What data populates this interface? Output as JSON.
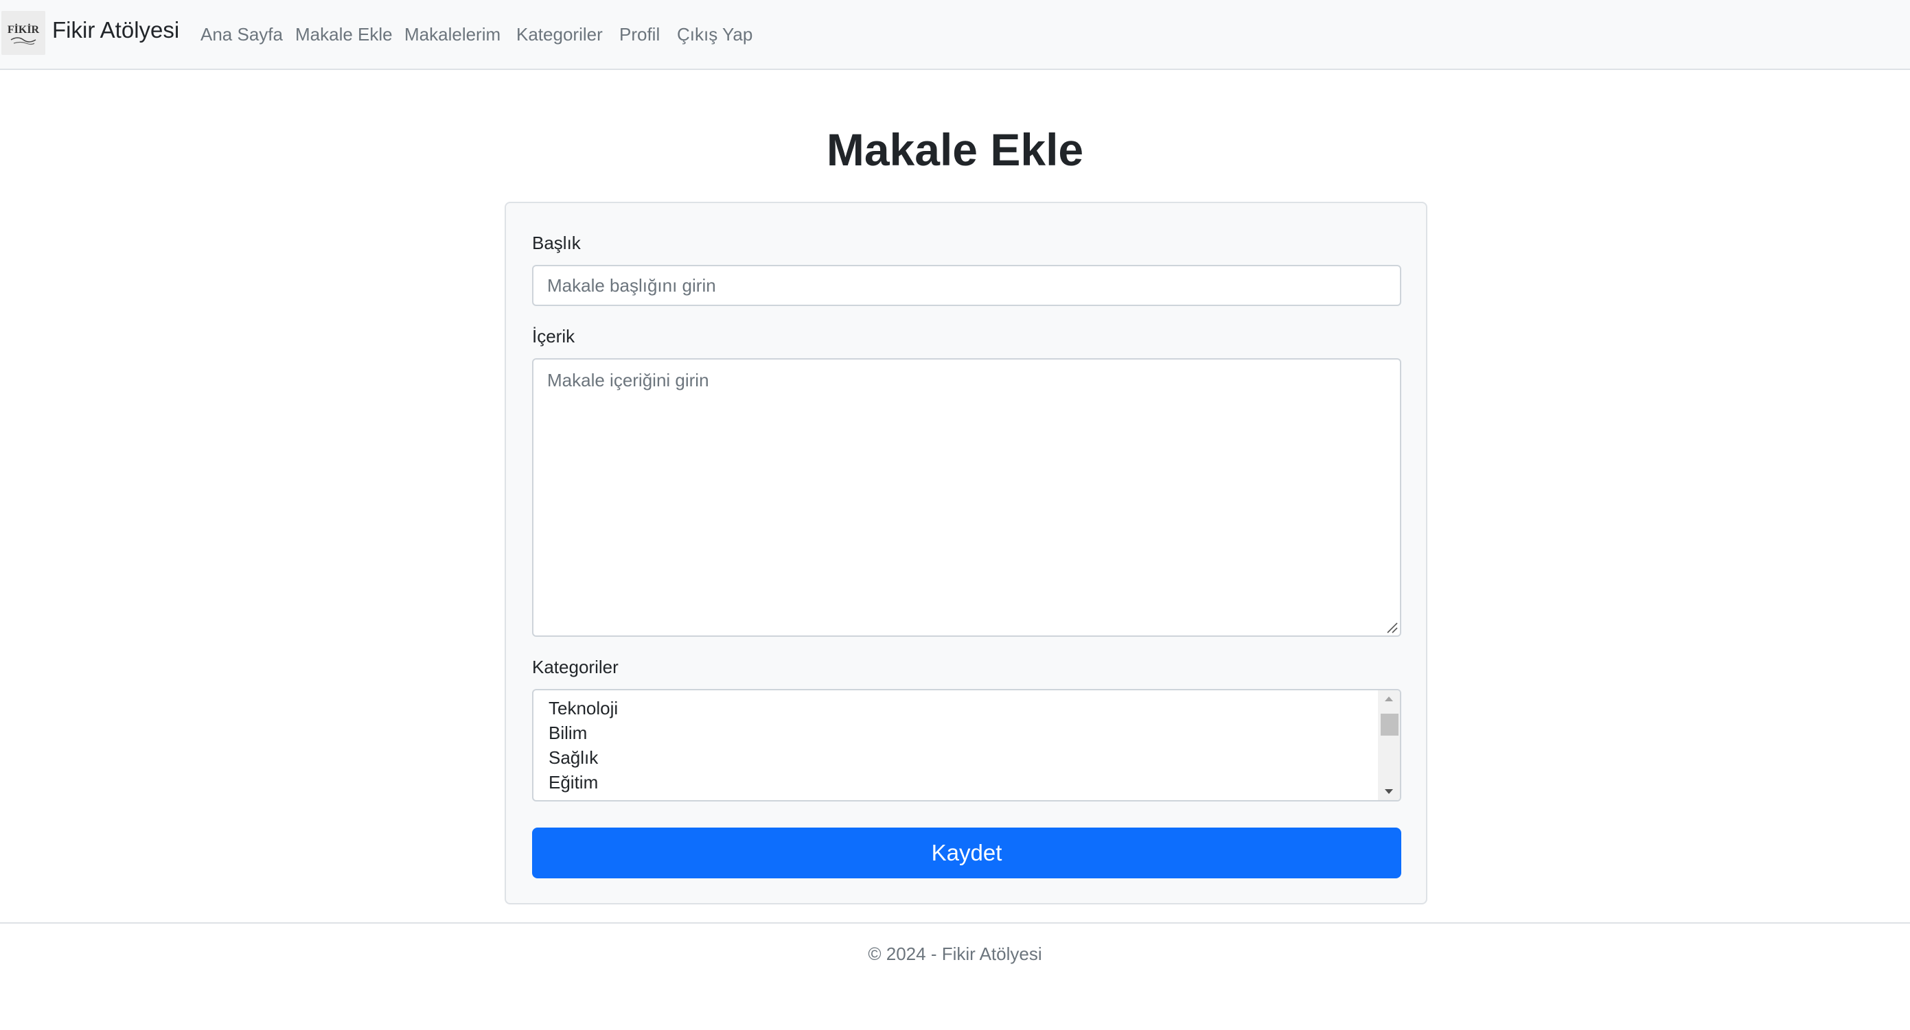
{
  "navbar": {
    "logo_icon": "fikir-atolyesi-logo",
    "logo_text": "FİKİR",
    "brand": "Fikir Atölyesi",
    "links": [
      {
        "label": "Ana Sayfa"
      },
      {
        "label": "Makale Ekle"
      },
      {
        "label": "Makalelerim"
      },
      {
        "label": "Kategoriler"
      },
      {
        "label": "Profil"
      },
      {
        "label": "Çıkış Yap"
      }
    ]
  },
  "page": {
    "title": "Makale Ekle"
  },
  "form": {
    "title_label": "Başlık",
    "title_value": "",
    "title_placeholder": "Makale başlığını girin",
    "content_label": "İçerik",
    "content_value": "",
    "content_placeholder": "Makale içeriğini girin",
    "categories_label": "Kategoriler",
    "categories": [
      "Teknoloji",
      "Bilim",
      "Sağlık",
      "Eğitim"
    ],
    "submit_label": "Kaydet"
  },
  "footer": {
    "text": "© 2024 - Fikir Atölyesi"
  },
  "colors": {
    "primary": "#0d6efd",
    "navbar_bg": "#f8f9fa",
    "muted_text": "#6c757d"
  }
}
